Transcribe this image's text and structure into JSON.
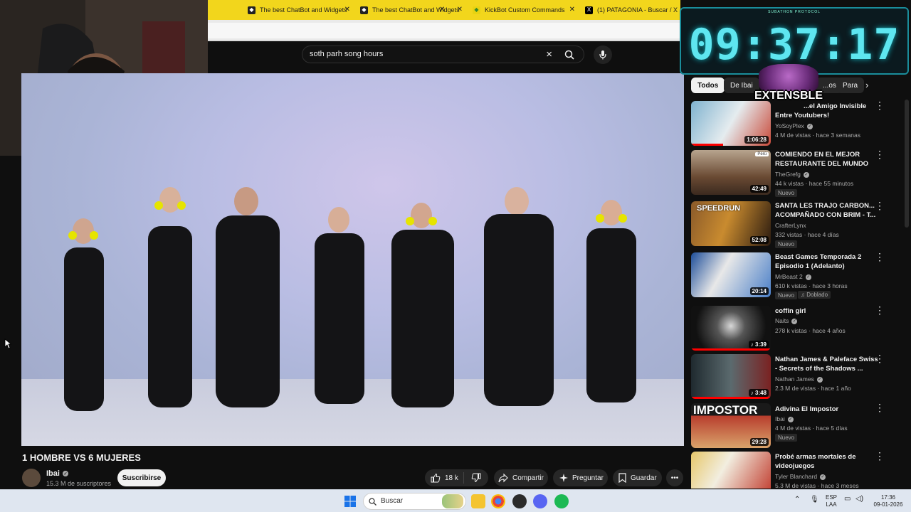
{
  "browser": {
    "tabs": [
      {
        "label": "",
        "icon": "tab-icon"
      },
      {
        "label": "The best ChatBot and Widgets",
        "icon": "kick-icon"
      },
      {
        "label": "The best ChatBot and Widgets",
        "icon": "kick-icon"
      },
      {
        "label": "KickBot Custom Commands",
        "icon": "kick-icon"
      },
      {
        "label": "(1) PATAGONIA - Buscar / X",
        "icon": "x-icon"
      }
    ]
  },
  "youtube": {
    "search_value": "soth parh song hours",
    "video": {
      "title": "1 HOMBRE VS 6 MUJERES",
      "channel": "Ibai",
      "subscribers": "15.3 M de suscriptores",
      "subscribe_label": "Suscribirse",
      "likes": "18 k",
      "share_label": "Compartir",
      "ask_label": "Preguntar",
      "save_label": "Guardar",
      "more_label": "•••"
    },
    "chips": [
      "Todos",
      "De Ibai",
      "...os",
      "Para"
    ],
    "recommendations": [
      {
        "title": "...el Amigo Invisible Entre Youtubers!",
        "title_l1": "...el Amigo Invisible",
        "title_l2": "Entre Youtubers!",
        "channel": "YoSoyPlex",
        "meta": "4 M de vistas · hace 3 semanas",
        "duration": "1:06:28",
        "new": "",
        "dub": ""
      },
      {
        "title": "COMIENDO EN EL MEJOR RESTAURANTE DEL MUNDO",
        "title_l1": "COMIENDO EN EL MEJOR",
        "title_l2": "RESTAURANTE DEL MUNDO",
        "channel": "TheGrefg",
        "meta": "44 k vistas · hace 55 minutos",
        "duration": "42:49",
        "new": "Nuevo",
        "dub": "",
        "badge": "Perú"
      },
      {
        "title": "SANTA LES TRAJO CARBON... ACOMPAÑADO CON BRIM - T...",
        "title_l1": "SANTA LES TRAJO CARBON...",
        "title_l2": "ACOMPAÑADO CON BRIM - T...",
        "channel": "CrafterLynx",
        "meta": "332 vistas · hace 4 días",
        "duration": "52:08",
        "new": "Nuevo",
        "dub": "",
        "thumb_text": "SPEEDRUN"
      },
      {
        "title": "Beast Games Temporada 2 Episodio 1 (Adelanto)",
        "title_l1": "Beast Games Temporada 2",
        "title_l2": "Episodio 1 (Adelanto)",
        "channel": "MrBeast 2",
        "meta": "610 k vistas · hace 3 horas",
        "duration": "20:14",
        "new": "Nuevo",
        "dub": "Doblado"
      },
      {
        "title": "coffin girl",
        "title_l1": "coffin girl",
        "title_l2": "",
        "channel": "Naits",
        "meta": "278 k vistas · hace 4 años",
        "duration": "♪ 3:39",
        "new": "",
        "dub": ""
      },
      {
        "title": "Nathan James & Paleface Swiss - Secrets of the Shadows ...",
        "title_l1": "Nathan James & Paleface Swiss",
        "title_l2": "- Secrets of the Shadows ...",
        "channel": "Nathan James",
        "meta": "2.3 M de vistas · hace 1 año",
        "duration": "♪ 3:48",
        "new": "",
        "dub": ""
      },
      {
        "title": "Adivina El Impostor",
        "title_l1": "Adivina El Impostor",
        "title_l2": "",
        "channel": "Ibai",
        "meta": "4 M de vistas · hace 5 días",
        "duration": "29:28",
        "new": "Nuevo",
        "dub": "",
        "thumb_text": "IMPOSTOR"
      },
      {
        "title": "Probé armas mortales de videojuegos",
        "title_l1": "Probé armas mortales de",
        "title_l2": "videojuegos",
        "channel": "Tyler Blanchard",
        "meta": "5.3 M de vistas · hace 3 meses",
        "duration": "",
        "new": "",
        "dub": ""
      }
    ]
  },
  "overlay": {
    "subathon_label": "SUBATHON PROTOCOL",
    "timer": "09:37:17",
    "extensible": "EXTENSBLE"
  },
  "taskbar": {
    "search_placeholder": "Buscar",
    "lang_top": "ESP",
    "lang_bottom": "LAA",
    "time": "17:36",
    "date": "09-01-2026"
  }
}
